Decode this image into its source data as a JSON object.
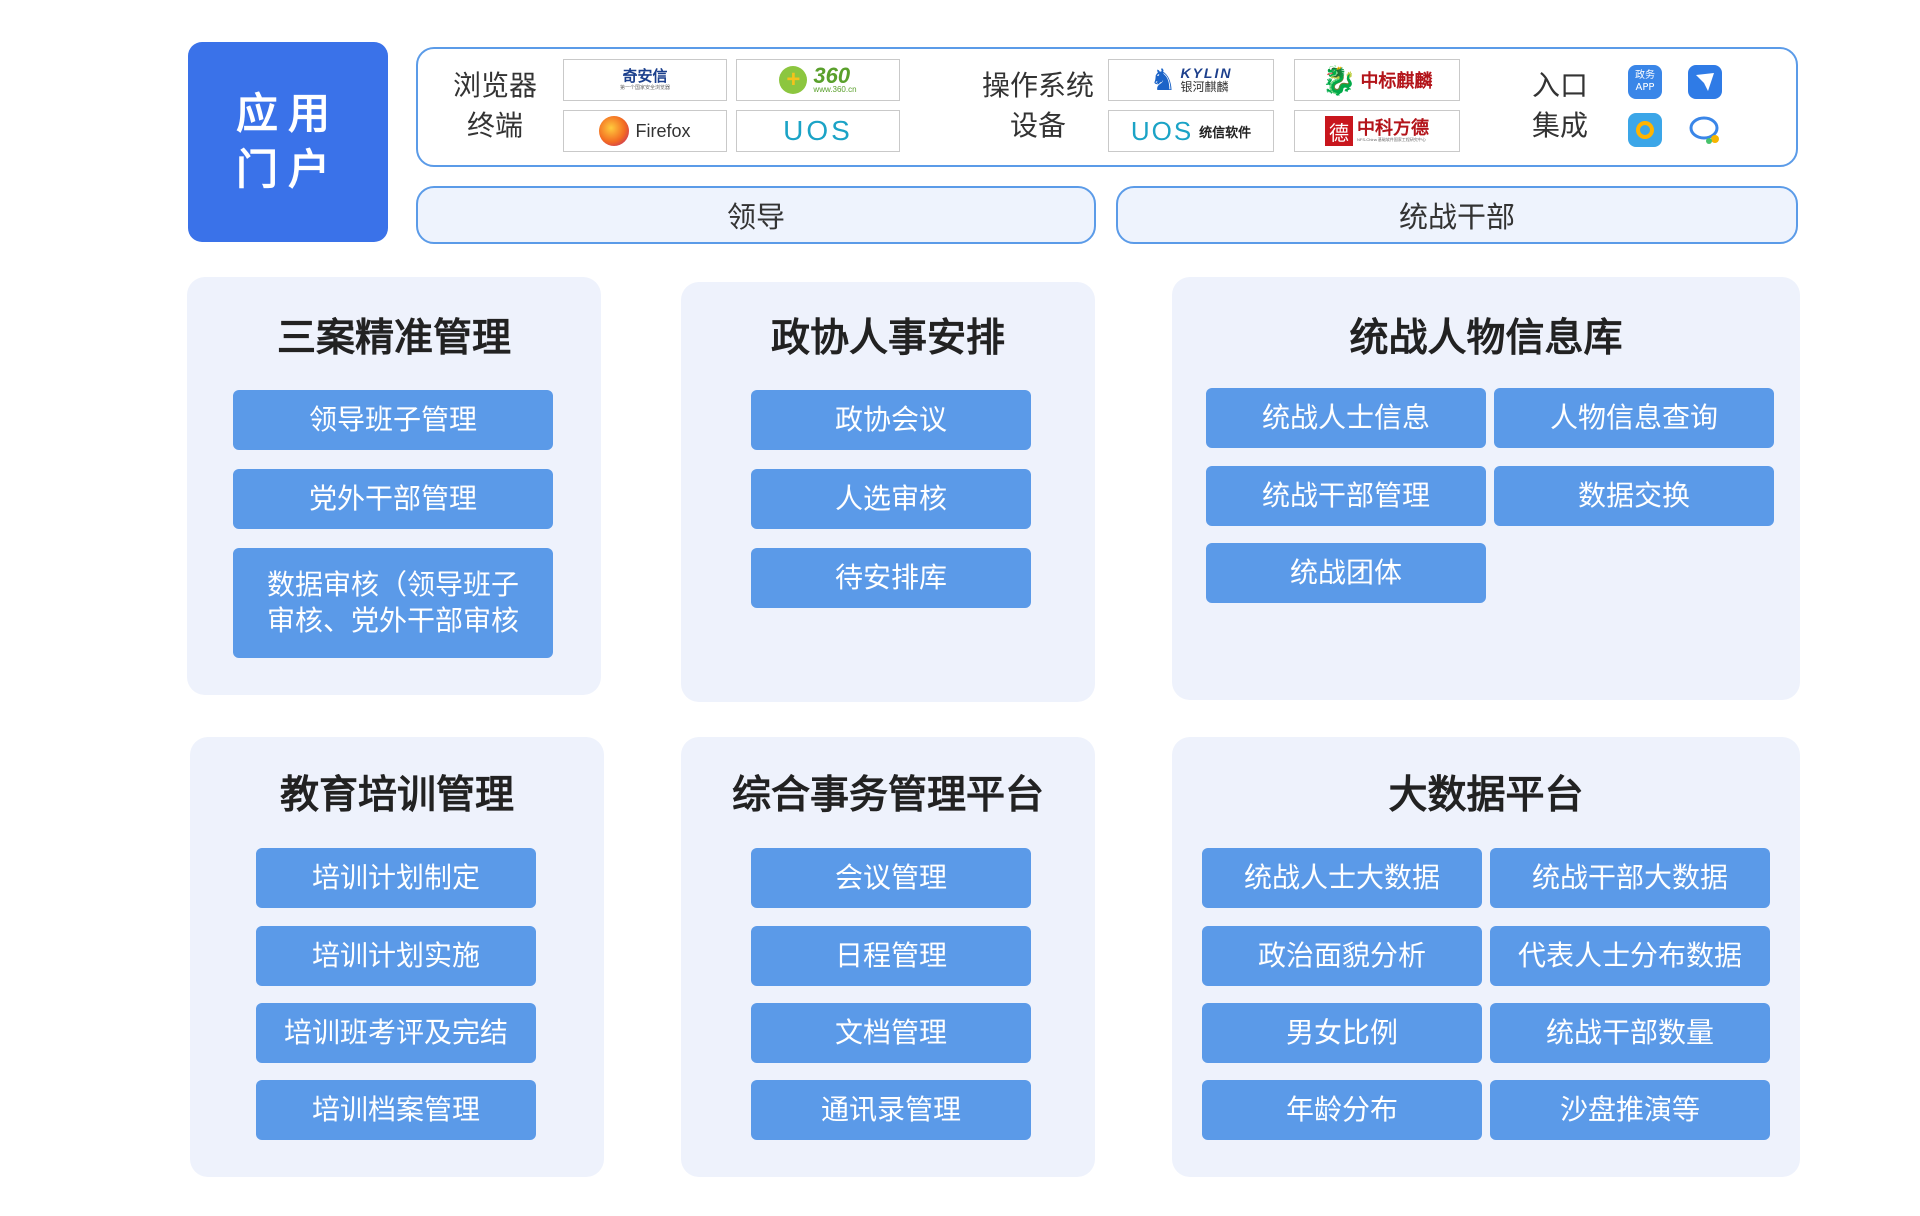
{
  "portal": {
    "line1": "应用",
    "line2": "门户"
  },
  "terminals": {
    "browser_line1": "浏览器",
    "browser_line2": "终端",
    "browsers": [
      {
        "name": "奇安信",
        "sub": "第一个国家安全浏览器"
      },
      {
        "name": "360",
        "sub": "www.360.cn"
      },
      {
        "name": "Firefox"
      },
      {
        "name": "UOS"
      }
    ],
    "os_line1": "操作系统",
    "os_line2": "设备",
    "os": [
      {
        "name": "KYLIN",
        "sub": "银河麒麟"
      },
      {
        "name": "中标麒麟"
      },
      {
        "name": "UOS",
        "sub": "统信软件"
      },
      {
        "name": "中科方德",
        "mark": "德",
        "sub": "NFS-China 基础软件国家工程研究中心"
      }
    ],
    "entry_line1": "入口",
    "entry_line2": "集成",
    "entry_icons": [
      {
        "icon": "government-app-icon",
        "line1": "政务",
        "line2": "APP",
        "color": "#3a86e8"
      },
      {
        "icon": "paper-plane-icon",
        "color": "#2f7be6"
      },
      {
        "icon": "camera-app-icon",
        "color": "#3ba6e8"
      },
      {
        "icon": "chat-bubble-icon",
        "color": "#3a86e8"
      }
    ]
  },
  "users": {
    "leader": "领导",
    "cadre": "统战干部"
  },
  "modules": {
    "m1": {
      "title": "三案精准管理",
      "items": [
        "领导班子管理",
        "党外干部管理"
      ],
      "multiline": [
        "数据审核（领导班子",
        "审核、党外干部审核"
      ]
    },
    "m2": {
      "title": "政协人事安排",
      "items": [
        "政协会议",
        "人选审核",
        "待安排库"
      ]
    },
    "m3": {
      "title": "统战人物信息库",
      "items": [
        "统战人士信息",
        "人物信息查询",
        "统战干部管理",
        "数据交换",
        "统战团体"
      ]
    },
    "m4": {
      "title": "教育培训管理",
      "items": [
        "培训计划制定",
        "培训计划实施",
        "培训班考评及完结",
        "培训档案管理"
      ]
    },
    "m5": {
      "title": "综合事务管理平台",
      "items": [
        "会议管理",
        "日程管理",
        "文档管理",
        "通讯录管理"
      ]
    },
    "m6": {
      "title": "大数据平台",
      "items": [
        "统战人士大数据",
        "统战干部大数据",
        "政治面貌分析",
        "代表人士分布数据",
        "男女比例",
        "统战干部数量",
        "年龄分布",
        "沙盘推演等"
      ]
    }
  },
  "colors": {
    "primary": "#3a72e9",
    "button": "#5b9ae8",
    "card": "#eef2fc",
    "border": "#5b9be8"
  }
}
